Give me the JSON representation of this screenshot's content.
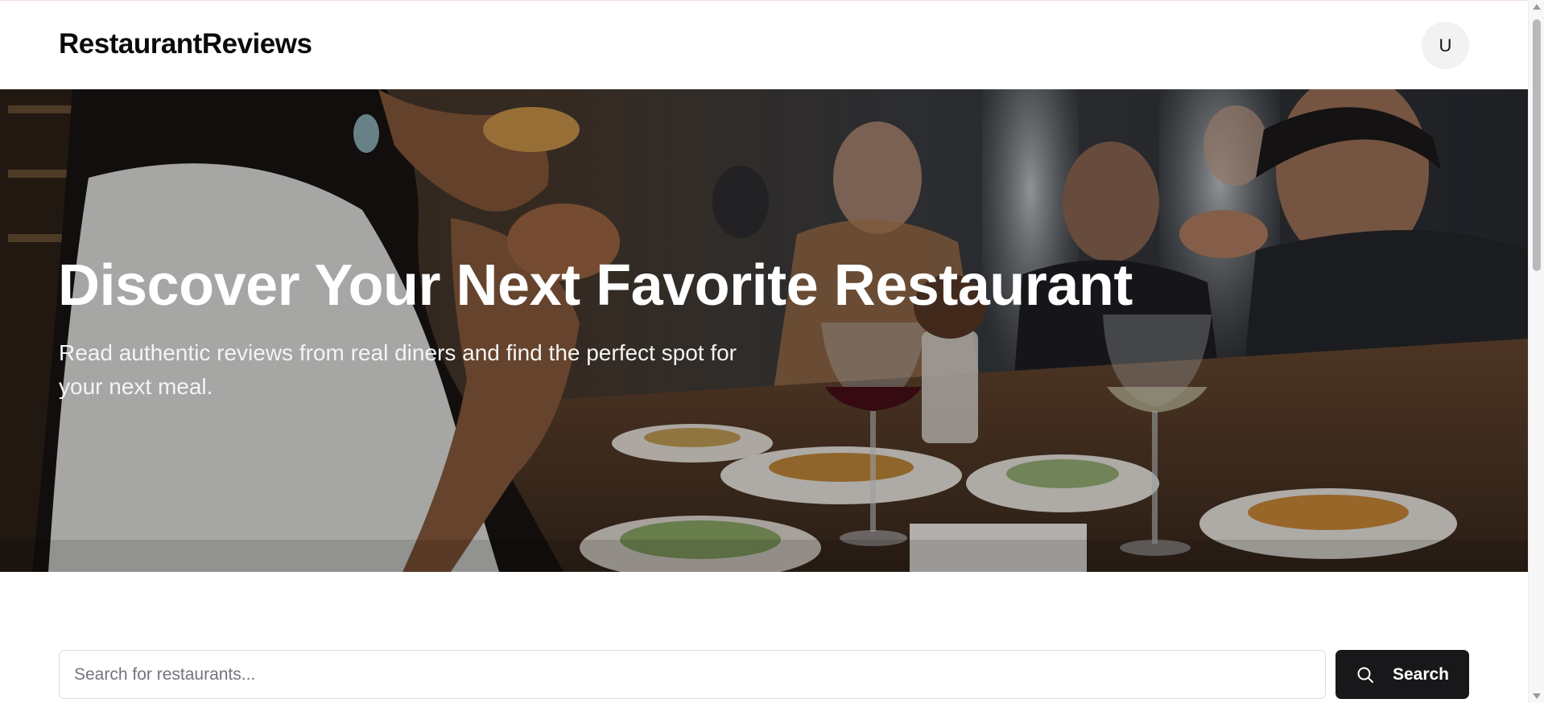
{
  "header": {
    "brand": "RestaurantReviews",
    "avatar_initial": "U"
  },
  "hero": {
    "title": "Discover Your Next Favorite Restaurant",
    "subtitle": "Read authentic reviews from real diners and find the perfect spot for your next meal.",
    "image_description": "people dining at a restaurant table with plates of food and wine glasses"
  },
  "search": {
    "placeholder": "Search for restaurants...",
    "value": "",
    "button_label": "Search",
    "button_icon": "search-icon"
  },
  "colors": {
    "button_bg": "#18181b",
    "avatar_bg": "#f2f2f3",
    "hero_text": "#ffffff"
  }
}
